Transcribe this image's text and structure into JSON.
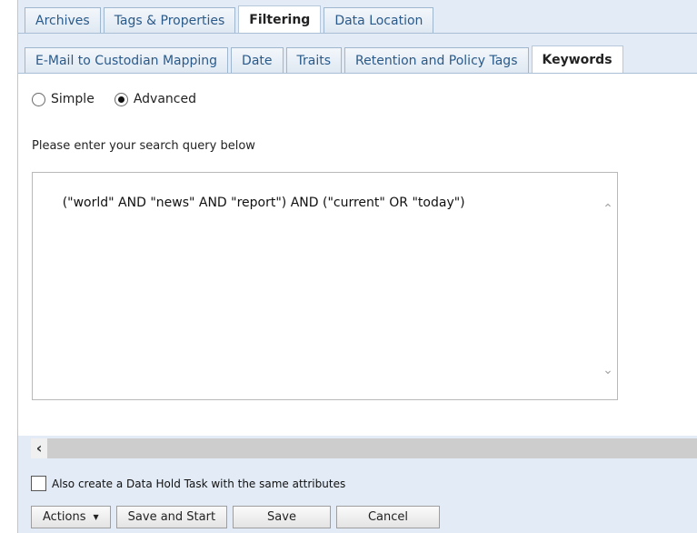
{
  "tabs_row1": [
    {
      "label": "Archives",
      "active": false
    },
    {
      "label": "Tags & Properties",
      "active": false
    },
    {
      "label": "Filtering",
      "active": true
    },
    {
      "label": "Data Location",
      "active": false
    }
  ],
  "tabs_row2": [
    {
      "label": "E-Mail to Custodian Mapping",
      "active": false
    },
    {
      "label": "Date",
      "active": false
    },
    {
      "label": "Traits",
      "active": false
    },
    {
      "label": "Retention and Policy Tags",
      "active": false
    },
    {
      "label": "Keywords",
      "active": true
    }
  ],
  "search_mode": {
    "simple_label": "Simple",
    "advanced_label": "Advanced",
    "selected": "Advanced"
  },
  "prompt": "Please enter your search query below",
  "query": "(\"world\" AND \"news\" AND \"report\") AND (\"current\" OR \"today\")",
  "icons": {
    "scroll_up": "chevron-up-icon",
    "scroll_down": "chevron-down-icon",
    "scroll_left": "chevron-left-icon",
    "dropdown": "caret-down-icon"
  },
  "hold_task": {
    "label": "Also create a Data Hold Task with the same attributes",
    "checked": false
  },
  "buttons": {
    "actions": "Actions",
    "save_and_start": "Save and Start",
    "save": "Save",
    "cancel": "Cancel"
  }
}
